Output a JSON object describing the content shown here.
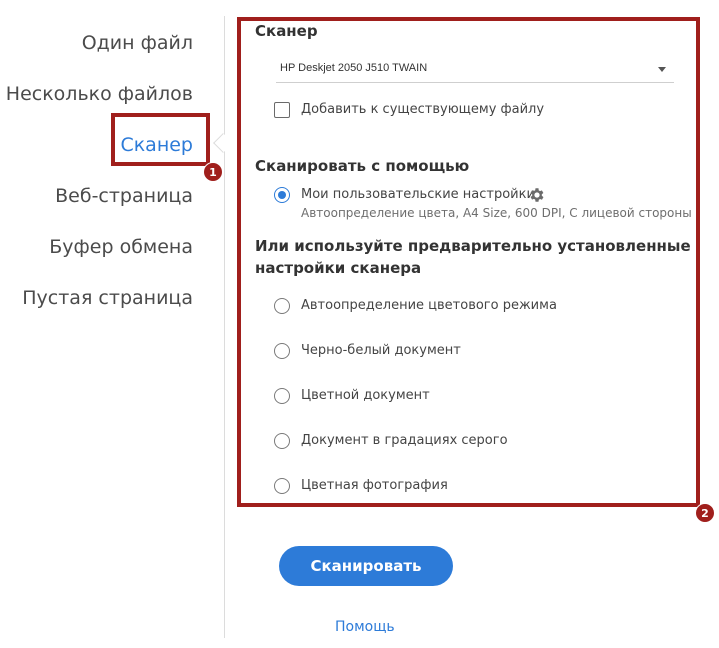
{
  "sidebar": {
    "items": [
      {
        "label": "Один файл"
      },
      {
        "label": "Несколько файлов"
      },
      {
        "label": "Сканер"
      },
      {
        "label": "Веб-страница"
      },
      {
        "label": "Буфер обмена"
      },
      {
        "label": "Пустая страница"
      }
    ],
    "active_index": 2
  },
  "callouts": {
    "first": "1",
    "second": "2",
    "color": "#a01f1c"
  },
  "scanner": {
    "title": "Сканер",
    "device": "HP Deskjet 2050 J510 TWAIN",
    "append_label": "Добавить к существующему файлу",
    "append_checked": false
  },
  "scan_with": {
    "title": "Сканировать с помощью",
    "custom_label": "Мои пользовательские настройки",
    "custom_desc": "Автоопределение цвета, A4 Size, 600 DPI, С лицевой стороны",
    "custom_selected": true,
    "gear_icon": "gear-icon"
  },
  "presets": {
    "title_line1": "Или используйте предварительно установленные",
    "title_line2": "настройки сканера",
    "options": [
      {
        "label": "Автоопределение цветового режима"
      },
      {
        "label": "Черно-белый документ"
      },
      {
        "label": "Цветной документ"
      },
      {
        "label": "Документ в градациях серого"
      },
      {
        "label": "Цветная фотография"
      }
    ]
  },
  "actions": {
    "scan_label": "Сканировать",
    "help_label": "Помощь"
  },
  "colors": {
    "accent": "#2d7bd8",
    "text": "#4b4b4b"
  }
}
